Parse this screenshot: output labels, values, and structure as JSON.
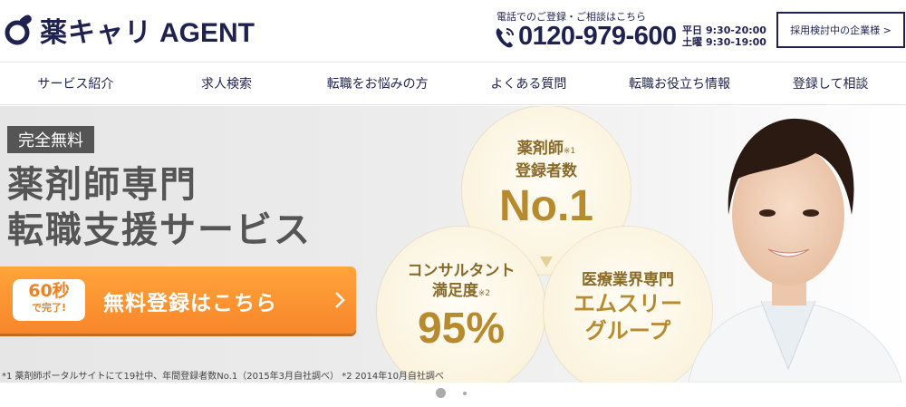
{
  "brand": {
    "logo_ja": "薬キャリ",
    "logo_en": "AGENT",
    "color": "#1f2251"
  },
  "contact": {
    "caption": "電話でのご登録・ご相談はこちら",
    "phone": "0120-979-600",
    "hours": [
      {
        "label": "平日",
        "time": "9:30-20:00"
      },
      {
        "label": "土曜",
        "time": "9:30-19:00"
      }
    ]
  },
  "corp_button": "採用検討中の企業様 >",
  "nav": [
    "サービス紹介",
    "求人検索",
    "転職をお悩みの方",
    "よくある質問",
    "転職お役立ち情報",
    "登録して相談"
  ],
  "hero": {
    "badge": "完全無料",
    "headline_line1": "薬剤師専門",
    "headline_line2": "転職支援サービス",
    "cta": {
      "seconds": "60秒",
      "done": "で完了!",
      "label": "無料登録はこちら",
      "color": "#f8862b"
    },
    "circles": [
      {
        "line1": "薬剤師",
        "note": "※1",
        "line2": "登録者数",
        "big": "No.1"
      },
      {
        "line1": "コンサルタント",
        "line2": "満足度",
        "note": "※2",
        "big": "95%"
      },
      {
        "line1": "医療業界専門",
        "big_line1": "エムスリー",
        "big_line2": "グループ"
      }
    ],
    "footnote": "*1 薬剤師ポータルサイトにて19社中、年間登録者数No.1（2015年3月自社調べ） *2 2014年10月自社調べ"
  },
  "pager": {
    "total": 2,
    "active": 1
  }
}
